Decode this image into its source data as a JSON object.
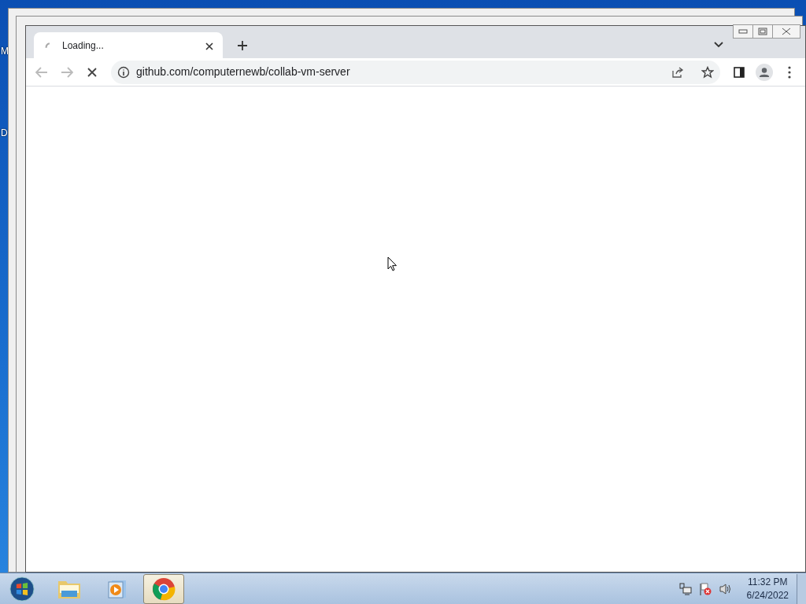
{
  "desktop": {
    "icon_labels": [
      "M",
      "D"
    ]
  },
  "browser": {
    "tabs": [
      {
        "title": "Loading...",
        "selected": true,
        "loading": true
      }
    ],
    "address": "github.com/computernewb/collab-vm-server",
    "page_loading": true
  },
  "taskbar": {
    "items": [
      {
        "kind": "explorer",
        "selected": false
      },
      {
        "kind": "media",
        "selected": false
      },
      {
        "kind": "chrome",
        "selected": true
      }
    ],
    "clock": {
      "time": "11:32 PM",
      "date": "6/24/2022"
    }
  }
}
